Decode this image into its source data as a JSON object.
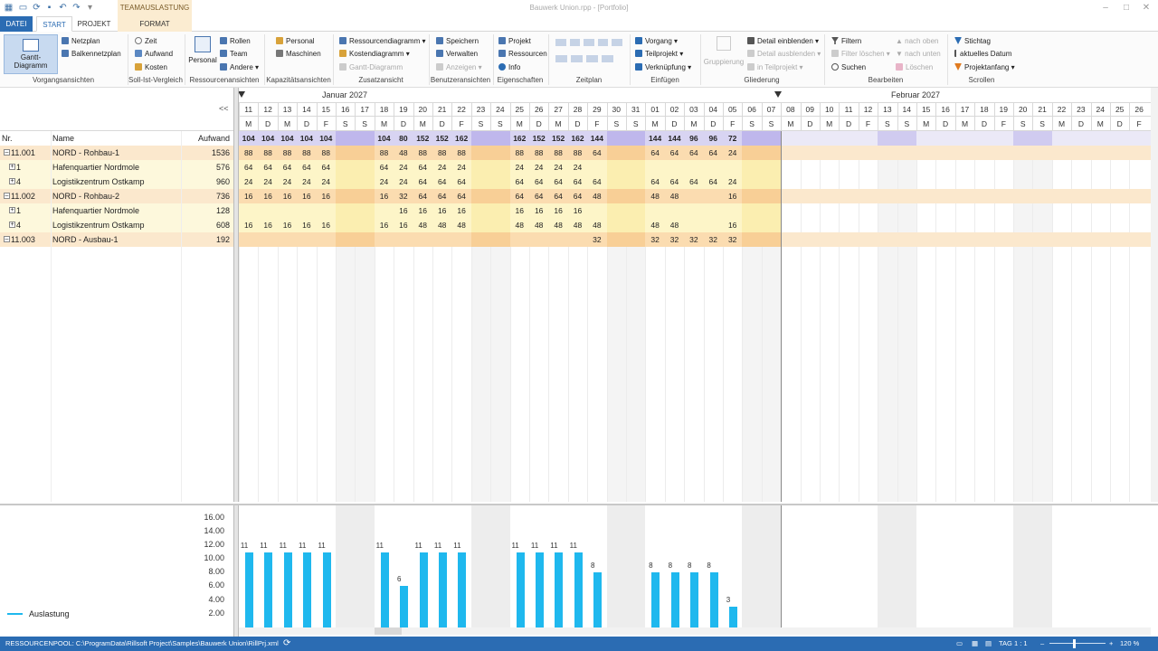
{
  "window": {
    "title": "Bauwerk Union.rpp - [Portfolio]",
    "context_tab": "TEAMAUSLASTUNG"
  },
  "tabs": {
    "file": "DATEI",
    "start": "START",
    "project": "PROJEKT",
    "format": "FORMAT"
  },
  "ribbon": {
    "gantt": "Gantt-Diagramm",
    "netzplan": "Netzplan",
    "balkennetzplan": "Balkennetzplan",
    "g_vorgang": "Vorgangsansichten",
    "zeit": "Zeit",
    "aufwand": "Aufwand",
    "kosten": "Kosten",
    "g_soll": "Soll-Ist-Vergleich",
    "personal_big": "Personal",
    "rollen": "Rollen",
    "team": "Team",
    "andere": "Andere",
    "g_ress": "Ressourcenansichten",
    "personal": "Personal",
    "maschinen": "Maschinen",
    "g_kap": "Kapazitätsansichten",
    "ressdiagramm": "Ressourcendiagramm",
    "kostendiagramm": "Kostendiagramm",
    "ganttdiag": "Gantt-Diagramm",
    "g_zusatz": "Zusatzansicht",
    "speichern": "Speichern",
    "verwalten": "Verwalten",
    "anzeigen": "Anzeigen",
    "g_benutzer": "Benutzeransichten",
    "projekt": "Projekt",
    "ressourcen": "Ressourcen",
    "info": "Info",
    "g_eig": "Eigenschaften",
    "g_zeitplan": "Zeitplan",
    "vorgang": "Vorgang",
    "teilprojekt": "Teilprojekt",
    "verknuepfung": "Verknüpfung",
    "g_einf": "Einfügen",
    "gruppierung": "Gruppierung",
    "detail_ein": "Detail einblenden",
    "detail_aus": "Detail ausblenden",
    "in_teilprojekt": "in Teilprojekt",
    "g_glied": "Gliederung",
    "filtern": "Filtern",
    "filter_loeschen": "Filter löschen",
    "suchen": "Suchen",
    "nach_oben": "nach oben",
    "nach_unten": "nach unten",
    "loeschen": "Löschen",
    "g_bearb": "Bearbeiten",
    "stichtag": "Stichtag",
    "akt_datum": "aktuelles Datum",
    "projektanfang": "Projektanfang",
    "g_scroll": "Scrollen"
  },
  "grid": {
    "col_nr": "Nr.",
    "col_name": "Name",
    "col_aufwand": "Aufwand",
    "collapse": "<<",
    "month1": "Januar 2027",
    "month2": "Februar 2027",
    "days": [
      "11",
      "12",
      "13",
      "14",
      "15",
      "16",
      "17",
      "18",
      "19",
      "20",
      "21",
      "22",
      "23",
      "24",
      "25",
      "26",
      "27",
      "28",
      "29",
      "30",
      "31",
      "01",
      "02",
      "03",
      "04",
      "05",
      "06",
      "07",
      "08",
      "09",
      "10",
      "11",
      "12",
      "13",
      "14",
      "15",
      "16",
      "17",
      "18",
      "19",
      "20",
      "21",
      "22",
      "23",
      "24",
      "25",
      "26"
    ],
    "weekdays": [
      "M",
      "D",
      "M",
      "D",
      "F",
      "S",
      "S",
      "M",
      "D",
      "M",
      "D",
      "F",
      "S",
      "S",
      "M",
      "D",
      "M",
      "D",
      "F",
      "S",
      "S",
      "M",
      "D",
      "M",
      "D",
      "F",
      "S",
      "S",
      "M",
      "D",
      "M",
      "D",
      "F",
      "S",
      "S",
      "M",
      "D",
      "M",
      "D",
      "F",
      "S",
      "S",
      "M",
      "D",
      "M",
      "D",
      "F"
    ],
    "summary": [
      "104",
      "104",
      "104",
      "104",
      "104",
      "",
      "",
      "104",
      "80",
      "152",
      "152",
      "162",
      "",
      "",
      "162",
      "152",
      "152",
      "162",
      "144",
      "",
      "",
      "144",
      "144",
      "96",
      "96",
      "72",
      "",
      ""
    ],
    "rows": [
      {
        "nr": "11.001",
        "name": "NORD - Rohbau-1",
        "aufwand": "1536",
        "level": 0,
        "vals": [
          "88",
          "88",
          "88",
          "88",
          "88",
          "",
          "",
          "88",
          "48",
          "88",
          "88",
          "88",
          "",
          "",
          "88",
          "88",
          "88",
          "88",
          "64",
          "",
          "",
          "64",
          "64",
          "64",
          "64",
          "24",
          "",
          ""
        ]
      },
      {
        "nr": "1",
        "name": "Hafenquartier Nordmole",
        "aufwand": "576",
        "level": 1,
        "vals": [
          "64",
          "64",
          "64",
          "64",
          "64",
          "",
          "",
          "64",
          "24",
          "64",
          "24",
          "24",
          "",
          "",
          "24",
          "24",
          "24",
          "24",
          "",
          "",
          "",
          "",
          "",
          "",
          "",
          "",
          "",
          ""
        ]
      },
      {
        "nr": "4",
        "name": "Logistikzentrum Ostkamp",
        "aufwand": "960",
        "level": 1,
        "vals": [
          "24",
          "24",
          "24",
          "24",
          "24",
          "",
          "",
          "24",
          "24",
          "64",
          "64",
          "64",
          "",
          "",
          "64",
          "64",
          "64",
          "64",
          "64",
          "",
          "",
          "64",
          "64",
          "64",
          "64",
          "24",
          "",
          ""
        ]
      },
      {
        "nr": "11.002",
        "name": "NORD - Rohbau-2",
        "aufwand": "736",
        "level": 0,
        "vals": [
          "16",
          "16",
          "16",
          "16",
          "16",
          "",
          "",
          "16",
          "32",
          "64",
          "64",
          "64",
          "",
          "",
          "64",
          "64",
          "64",
          "64",
          "48",
          "",
          "",
          "48",
          "48",
          "",
          "",
          "16",
          "",
          ""
        ]
      },
      {
        "nr": "1",
        "name": "Hafenquartier Nordmole",
        "aufwand": "128",
        "level": 1,
        "vals": [
          "",
          "",
          "",
          "",
          "",
          "",
          "",
          "",
          "16",
          "16",
          "16",
          "16",
          "",
          "",
          "16",
          "16",
          "16",
          "16",
          "",
          "",
          "",
          "",
          "",
          "",
          "",
          "",
          "",
          ""
        ]
      },
      {
        "nr": "4",
        "name": "Logistikzentrum Ostkamp",
        "aufwand": "608",
        "level": 1,
        "vals": [
          "16",
          "16",
          "16",
          "16",
          "16",
          "",
          "",
          "16",
          "16",
          "48",
          "48",
          "48",
          "",
          "",
          "48",
          "48",
          "48",
          "48",
          "48",
          "",
          "",
          "48",
          "48",
          "",
          "",
          "16",
          "",
          ""
        ]
      },
      {
        "nr": "11.003",
        "name": "NORD - Ausbau-1",
        "aufwand": "192",
        "level": 0,
        "vals": [
          "",
          "",
          "",
          "",
          "",
          "",
          "",
          "",
          "",
          "",
          "",
          "",
          "",
          "",
          "",
          "",
          "",
          "",
          "32",
          "",
          "",
          "32",
          "32",
          "32",
          "32",
          "32",
          "",
          ""
        ]
      }
    ]
  },
  "chart": {
    "legend": "Auslastung",
    "yticks": [
      "16.00",
      "14.00",
      "12.00",
      "10.00",
      "8.00",
      "6.00",
      "4.00",
      "2.00"
    ]
  },
  "chart_data": {
    "type": "bar",
    "categories": [
      "11",
      "12",
      "13",
      "14",
      "15",
      "16",
      "17",
      "18",
      "19",
      "20",
      "21",
      "22",
      "23",
      "24",
      "25",
      "26",
      "27",
      "28",
      "29",
      "30",
      "31",
      "01",
      "02",
      "03",
      "04",
      "05"
    ],
    "series": [
      {
        "name": "Auslastung",
        "values": [
          11,
          11,
          11,
          11,
          11,
          null,
          null,
          11,
          6,
          11,
          11,
          11,
          null,
          null,
          11,
          11,
          11,
          11,
          8,
          null,
          null,
          8,
          8,
          8,
          8,
          3
        ]
      }
    ],
    "ylim": [
      0,
      17
    ],
    "color": "#1fb8ee"
  },
  "statusbar": {
    "path": "RESSOURCENPOOL: C:\\ProgramData\\Rillsoft Project\\Samples\\Bauwerk Union\\RillPrj.xml",
    "scale": "TAG 1 : 1",
    "zoom": "120 %"
  }
}
